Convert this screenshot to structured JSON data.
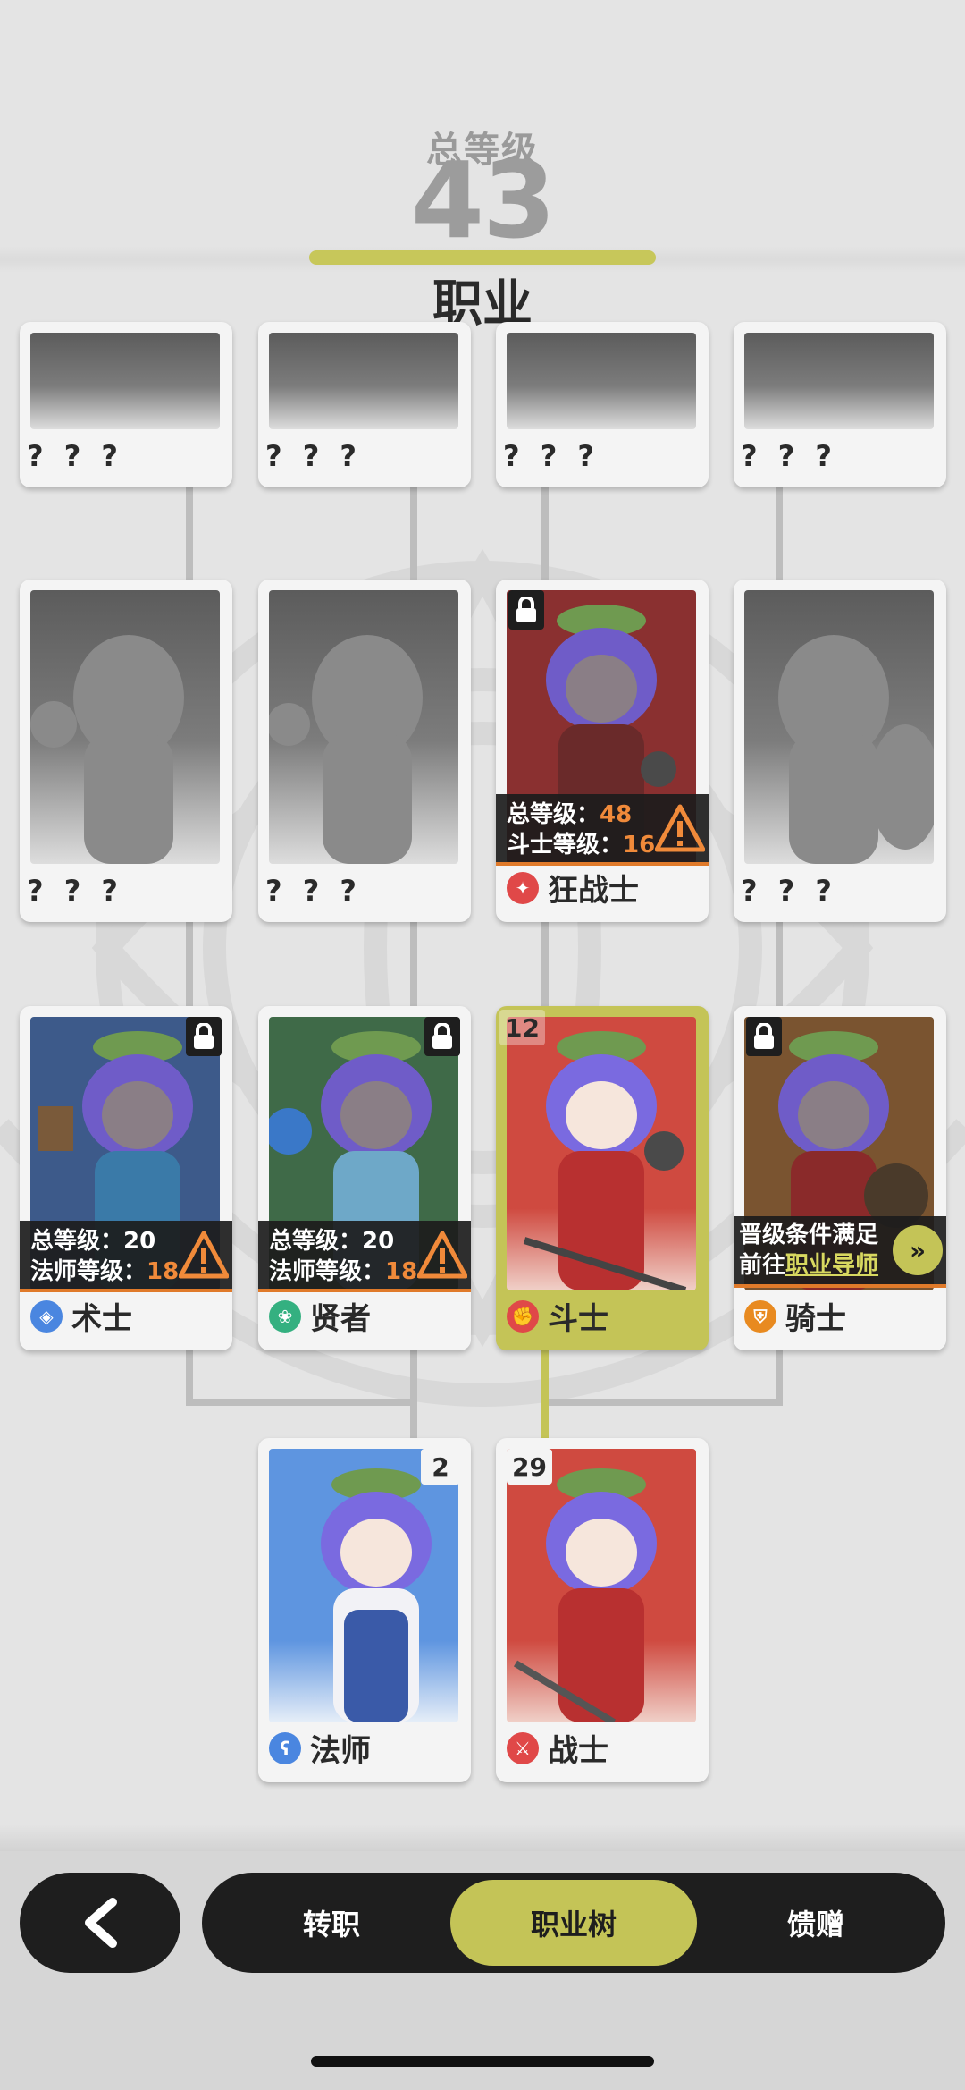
{
  "header": {
    "total_level_label": "总等级",
    "total_level_value": "43",
    "title": "职业"
  },
  "cards": {
    "unknown_label": "? ? ?",
    "berserker": {
      "name": "狂战士",
      "req_total_label": "总等级：",
      "req_total_value": "48",
      "req_class_label": "斗士等级：",
      "req_class_value": "16"
    },
    "warlock": {
      "name": "术士",
      "req_total_label": "总等级：",
      "req_total_value": "20",
      "req_class_label": "法师等级：",
      "req_class_value": "18"
    },
    "sage": {
      "name": "贤者",
      "req_total_label": "总等级：",
      "req_total_value": "20",
      "req_class_label": "法师等级：",
      "req_class_value": "18"
    },
    "fighter": {
      "name": "斗士",
      "level": "12"
    },
    "knight": {
      "name": "骑士",
      "promo_line1": "晋级条件满足",
      "promo_prefix": "前往",
      "promo_link": "职业导师"
    },
    "mage": {
      "name": "法师",
      "level": "2"
    },
    "warrior": {
      "name": "战士",
      "level": "29"
    }
  },
  "nav": {
    "tabs": [
      "转职",
      "职业树",
      "馈赠"
    ],
    "selected_tab": "职业树"
  },
  "colors": {
    "accent": "#c4c457",
    "warning": "#f08a3a",
    "bar_dark": "#1e1e1e",
    "berserker_bg": "#8a3030",
    "warlock_bg": "#3d5a8a",
    "sage_bg": "#3f6a48",
    "fighter_bg": "#cf4a40",
    "knight_bg": "#7a5430",
    "mage_bg": "#5e95e0",
    "warrior_bg": "#cf4a40"
  }
}
